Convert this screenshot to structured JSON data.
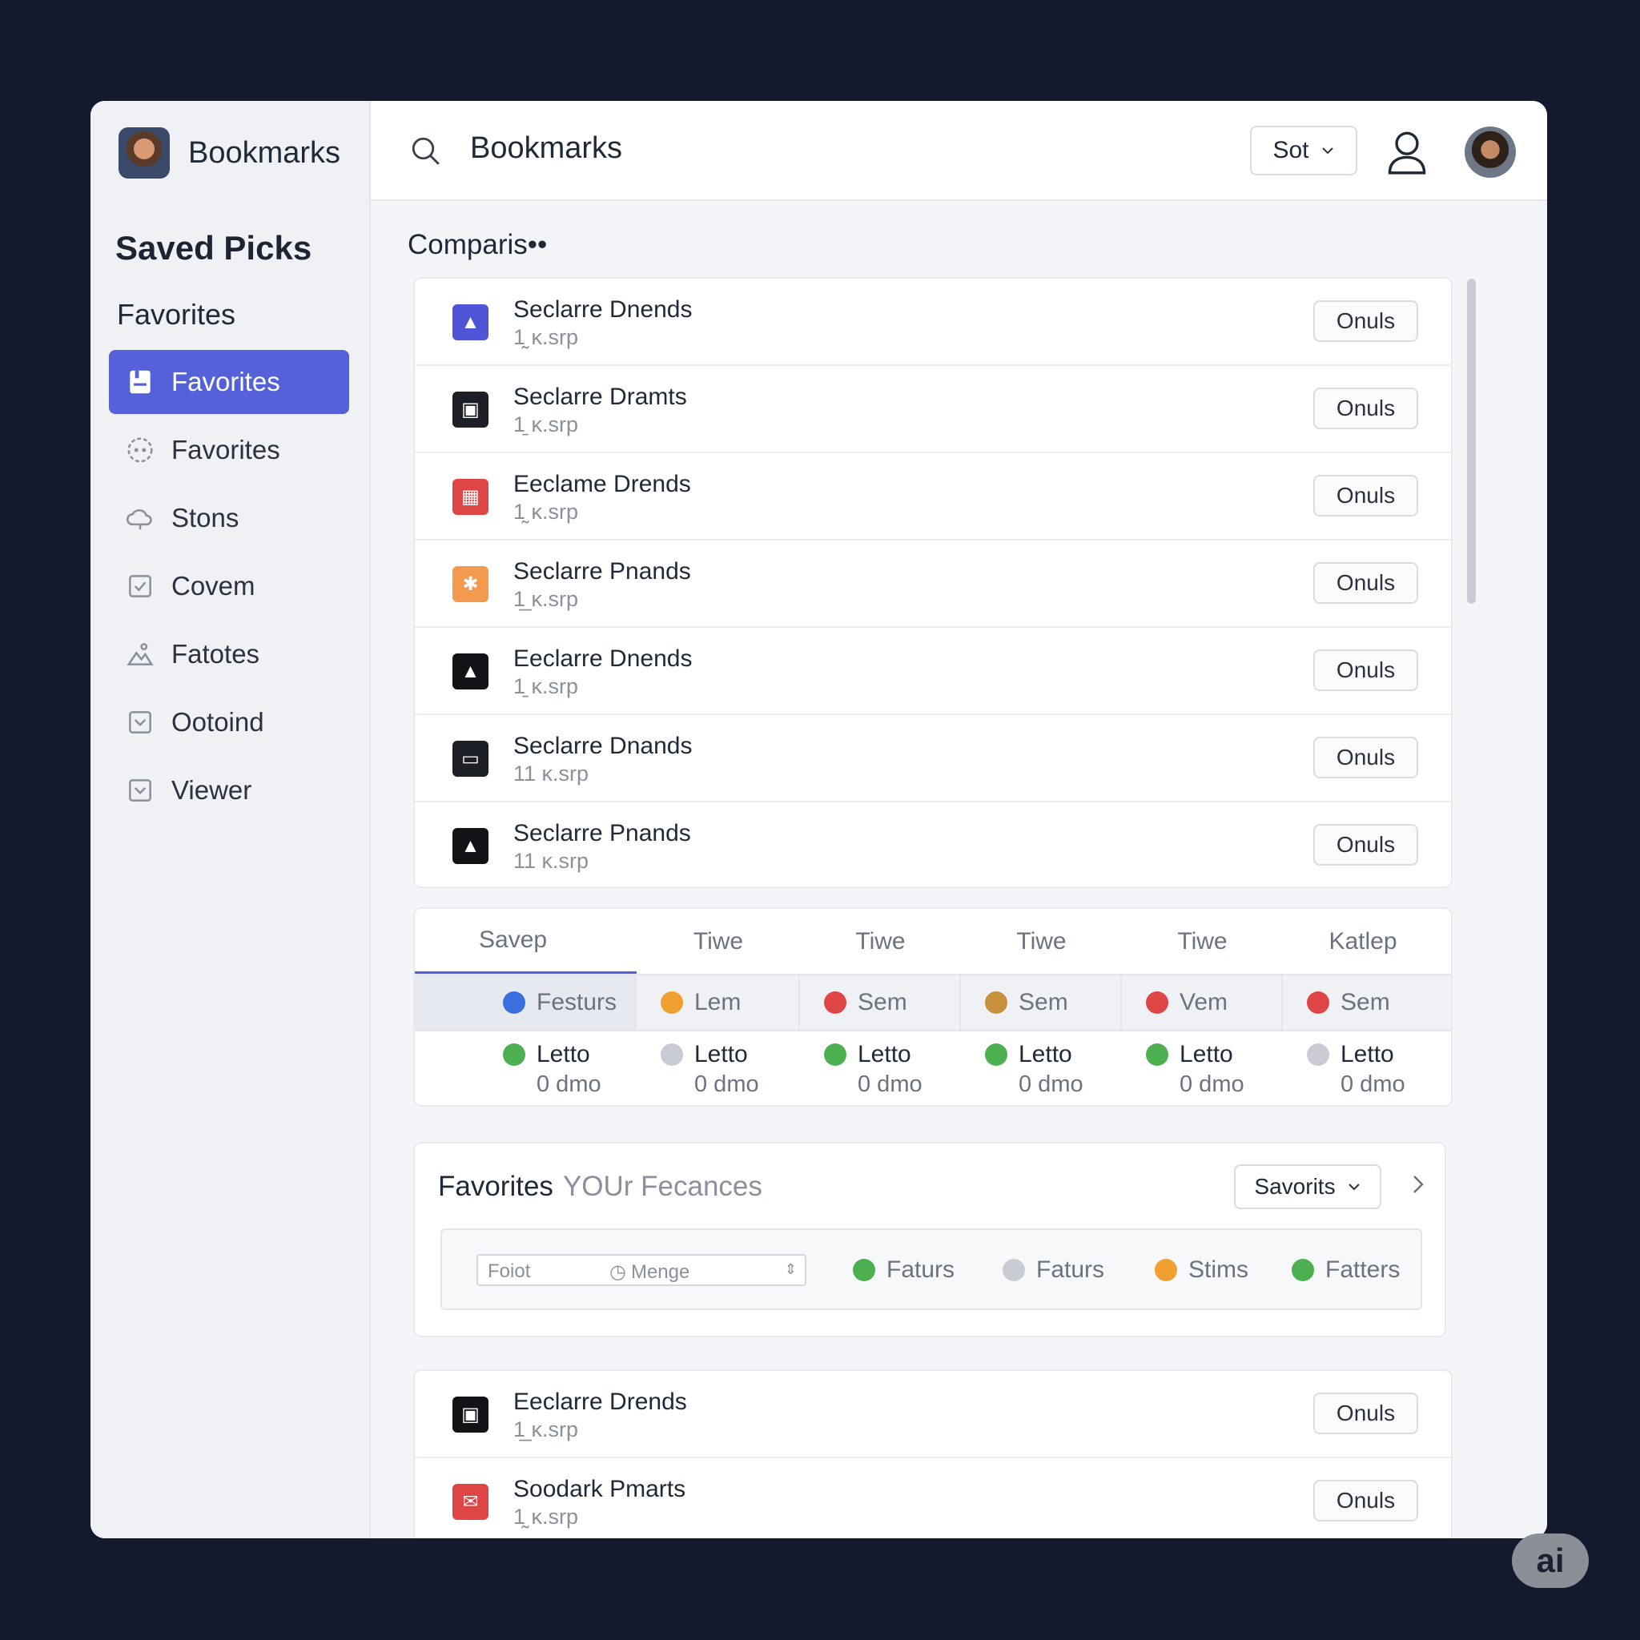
{
  "colors": {
    "accent": "#5561d8",
    "background": "#141a2e",
    "green": "#4caf50",
    "gray": "#c9ccd4",
    "orange": "#f0a030",
    "red": "#e04545",
    "blue": "#3b6fe0",
    "tan": "#c8913e"
  },
  "sidebar": {
    "app_name": "Bookmarks",
    "title": "Saved Picks",
    "subtitle": "Favorites",
    "items": [
      {
        "label": "Favorites",
        "icon": "bookmark-icon",
        "active": true
      },
      {
        "label": "Favorites",
        "icon": "dashed-circle-icon"
      },
      {
        "label": "Stons",
        "icon": "cloud-icon"
      },
      {
        "label": "Covem",
        "icon": "check-square-icon"
      },
      {
        "label": "Fatotes",
        "icon": "landscape-icon"
      },
      {
        "label": "Ootoind",
        "icon": "chevron-square-icon"
      },
      {
        "label": "Viewer",
        "icon": "chevron-square-icon"
      }
    ]
  },
  "topbar": {
    "title": "Bookmarks",
    "sort_label": "Sot"
  },
  "main": {
    "section_title": "Comparis••",
    "rows": [
      {
        "title": "Seclarre Dnends",
        "sub": "1̰ ĸ.srp",
        "button": "Onuls",
        "icon_color": "#4f55d6",
        "icon": "triangle-icon"
      },
      {
        "title": "Seclarre Dramts",
        "sub": "1̱ ĸ.srp",
        "button": "Onuls",
        "icon_color": "#1c1f26",
        "icon": "box-icon"
      },
      {
        "title": "Eeclame Drends",
        "sub": "1̰ ĸ.srp",
        "button": "Onuls",
        "icon_color": "#e04545",
        "icon": "calendar-icon"
      },
      {
        "title": "Seclarre Pnands",
        "sub": "1̲ ĸ.srp",
        "button": "Onuls",
        "icon_color": "#f39a4e",
        "icon": "star-icon"
      },
      {
        "title": "Eeclarre Dnends",
        "sub": "1̱ ĸ.srp",
        "button": "Onuls",
        "icon_color": "#111317",
        "icon": "image-icon"
      },
      {
        "title": "Seclarre Dnands",
        "sub": "11 ĸ.srp",
        "button": "Onuls",
        "icon_color": "#1c1f26",
        "icon": "monitor-icon"
      },
      {
        "title": "Seclarre Pnands",
        "sub": "11 ĸ.srp",
        "button": "Onuls",
        "icon_color": "#111317",
        "icon": "image-icon"
      }
    ]
  },
  "comparison": {
    "headers": [
      "Savep",
      "Tiwe",
      "Tiwe",
      "Tiwe",
      "Tiwe",
      "Katlep"
    ],
    "row1": [
      {
        "label": "Festurs",
        "color": "#3b6fe0"
      },
      {
        "label": "Lem",
        "color": "#f0a030"
      },
      {
        "label": "Sem",
        "color": "#e04545"
      },
      {
        "label": "Sem",
        "color": "#c8913e"
      },
      {
        "label": "Vem",
        "color": "#e04545"
      },
      {
        "label": "Sem",
        "color": "#e04545"
      }
    ],
    "row2": [
      {
        "label": "Letto",
        "sub": "0 dmo",
        "color": "#4caf50"
      },
      {
        "label": "Letto",
        "sub": "0 dmo",
        "color": "#c9ccd4"
      },
      {
        "label": "Letto",
        "sub": "0 dmo",
        "color": "#4caf50"
      },
      {
        "label": "Letto",
        "sub": "0 dmo",
        "color": "#4caf50"
      },
      {
        "label": "Letto",
        "sub": "0 dmo",
        "color": "#4caf50"
      },
      {
        "label": "Letto",
        "sub": "0 dmo",
        "color": "#c9ccd4"
      }
    ]
  },
  "favorites_panel": {
    "title": "Favorites",
    "subtitle": "YOUr Fecances",
    "select_label": "Savorits",
    "input_placeholder": "Foiot",
    "input_value": "Menge",
    "legend": [
      {
        "label": "Faturs",
        "color": "#4caf50"
      },
      {
        "label": "Faturs",
        "color": "#c9ccd4"
      },
      {
        "label": "Stims",
        "color": "#f0a030"
      },
      {
        "label": "Fatters",
        "color": "#4caf50"
      }
    ]
  },
  "bottom_rows": [
    {
      "title": "Eeclarre Drends",
      "sub": "1̲ ĸ.srp",
      "button": "Onuls",
      "icon_color": "#111317",
      "icon": "box-icon"
    },
    {
      "title": "Soodark Pmarts",
      "sub": "1̰ ĸ.srp",
      "button": "Onuls",
      "icon_color": "#e04545",
      "icon": "mail-icon"
    }
  ],
  "badge": "ai"
}
